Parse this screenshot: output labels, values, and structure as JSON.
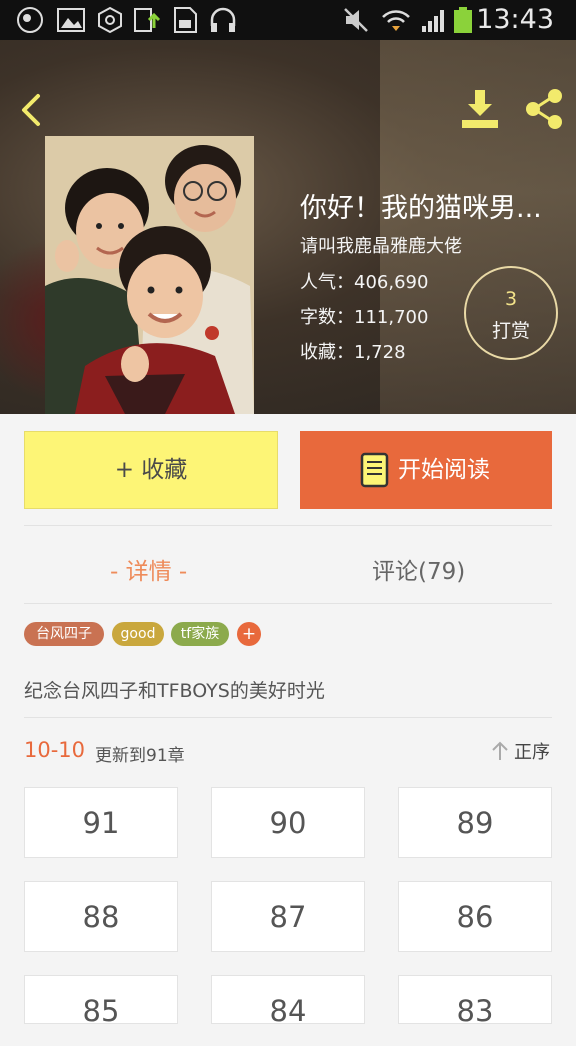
{
  "status_bar": {
    "time": "13:43",
    "icons": [
      "app-icon",
      "image-icon",
      "settings-hex-icon",
      "upload-icon",
      "sd-card-icon",
      "headphones-icon",
      "mute-icon",
      "wifi-icon",
      "signal-icon",
      "battery-icon"
    ]
  },
  "header": {
    "icons": [
      "back-icon",
      "download-icon",
      "share-icon"
    ]
  },
  "book": {
    "title": "你好！我的猫咪男...",
    "author": "请叫我鹿晶雅鹿大佬",
    "popularity": "人气：406,690",
    "word_count": "字数：111,700",
    "favorites": "收藏：1,728",
    "reward_count": "3",
    "reward_label": "打赏"
  },
  "actions": {
    "favorite_label": "+ 收藏",
    "read_label": "开始阅读",
    "read_color": "#e8693c",
    "favorite_color": "#fdf576"
  },
  "tabs": {
    "detail": "- 详情 -",
    "comments": "评论(79)"
  },
  "tags": [
    {
      "label": "台风四子",
      "color": "#c97252"
    },
    {
      "label": "good",
      "color": "#c9a73d"
    },
    {
      "label": "tf家族",
      "color": "#8caa4c"
    },
    {
      "label": "+",
      "color": "#e8693c"
    }
  ],
  "description": "纪念台风四子和TFBOYS的美好时光",
  "update": {
    "date": "10-10",
    "text": "更新到91章",
    "sort_label": "正序"
  },
  "chapters": [
    "91",
    "90",
    "89",
    "88",
    "87",
    "86",
    "85",
    "84",
    "83"
  ]
}
